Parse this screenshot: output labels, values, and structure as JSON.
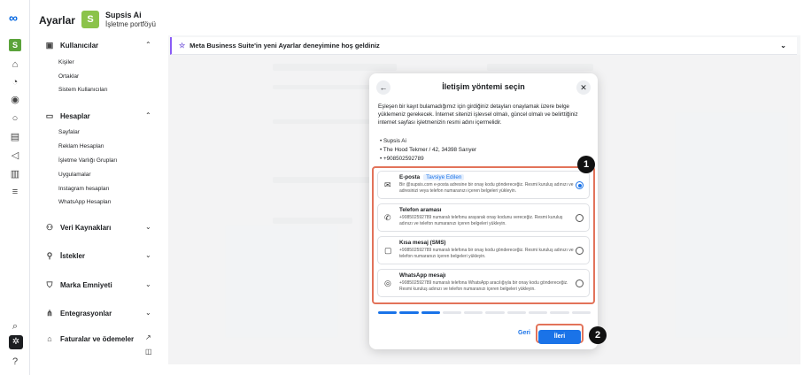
{
  "app": {
    "title": "Ayarlar"
  },
  "business": {
    "avatar_letter": "S",
    "name": "Supsis Ai",
    "subtitle": "İşletme portföyü"
  },
  "rail": {
    "icons": [
      "meta-logo-icon",
      "home-icon",
      "bell-icon",
      "compass-icon",
      "chat-icon",
      "calendar-icon",
      "megaphone-icon",
      "chart-icon",
      "menu-icon",
      "search-icon",
      "gear-icon",
      "help-icon"
    ],
    "avatar_letter": "S"
  },
  "sidebar": {
    "users": {
      "label": "Kullanıcılar",
      "items": [
        "Kişiler",
        "Ortaklar",
        "Sistem Kullanıcıları"
      ]
    },
    "accounts": {
      "label": "Hesaplar",
      "items": [
        "Sayfalar",
        "Reklam Hesapları",
        "İşletme Varlığı Grupları",
        "Uygulamalar",
        "Instagram hesapları",
        "WhatsApp Hesapları"
      ]
    },
    "data_sources": {
      "label": "Veri Kaynakları"
    },
    "requests": {
      "label": "İstekler"
    },
    "brand_safety": {
      "label": "Marka Emniyeti"
    },
    "integrations": {
      "label": "Entegrasyonlar"
    },
    "billing": {
      "label": "Faturalar ve ödemeler"
    }
  },
  "banner": {
    "text": "Meta Business Suite'in yeni Ayarlar deneyimine hoş geldiniz"
  },
  "modal": {
    "title": "İletişim yöntemi seçin",
    "description": "Eşleşen bir kayıt bulamadığımız için girdiğiniz detayları onaylamak üzere belge yüklemeniz gerekecek. İnternet sitenizi işlevsel olmalı, güncel olmalı ve belirttiğiniz internet sayfası işletmenizin resmi adını içermelidir.",
    "info": [
      "Supsis Ai",
      "The Hood Tekmer / 42, 34398 Sarıyer",
      "+908502592789"
    ],
    "options": [
      {
        "title": "E-posta",
        "badge": "Tavsiye Edilen",
        "desc": "Bir @supsis.com e-posta adresine bir onay kodu göndereceğiz. Resmi kuruluş adınızı ve adresinizi veya telefon numaranızı içeren belgeleri yükleyin.",
        "selected": true
      },
      {
        "title": "Telefon araması",
        "badge": "",
        "desc": "+908502592789 numaralı telefonu arayarak onay kodunu vereceğiz. Resmi kuruluş adınızı ve telefon numaranızı içeren belgeleri yükleyin.",
        "selected": false
      },
      {
        "title": "Kısa mesaj (SMS)",
        "badge": "",
        "desc": "+908502592789 numaralı telefona bir onay kodu göndereceğiz. Resmi kuruluş adınızı ve telefon numaranızı içeren belgeleri yükleyin.",
        "selected": false
      },
      {
        "title": "WhatsApp mesajı",
        "badge": "",
        "desc": "+908502592789 numaralı telefona WhatsApp aracılığıyla bir onay kodu göndereceğiz. Resmi kuruluş adınızı ve telefon numaranızı içeren belgeleri yükleyin.",
        "selected": false
      }
    ],
    "progress": {
      "completed_steps": 3,
      "total_steps": 10
    },
    "back_label": "Geri",
    "next_label": "İleri"
  },
  "markers": {
    "one": "1",
    "two": "2"
  },
  "colors": {
    "accent": "#1a73e8",
    "highlight": "#e2735a",
    "banner_accent": "#8a5cf6"
  }
}
